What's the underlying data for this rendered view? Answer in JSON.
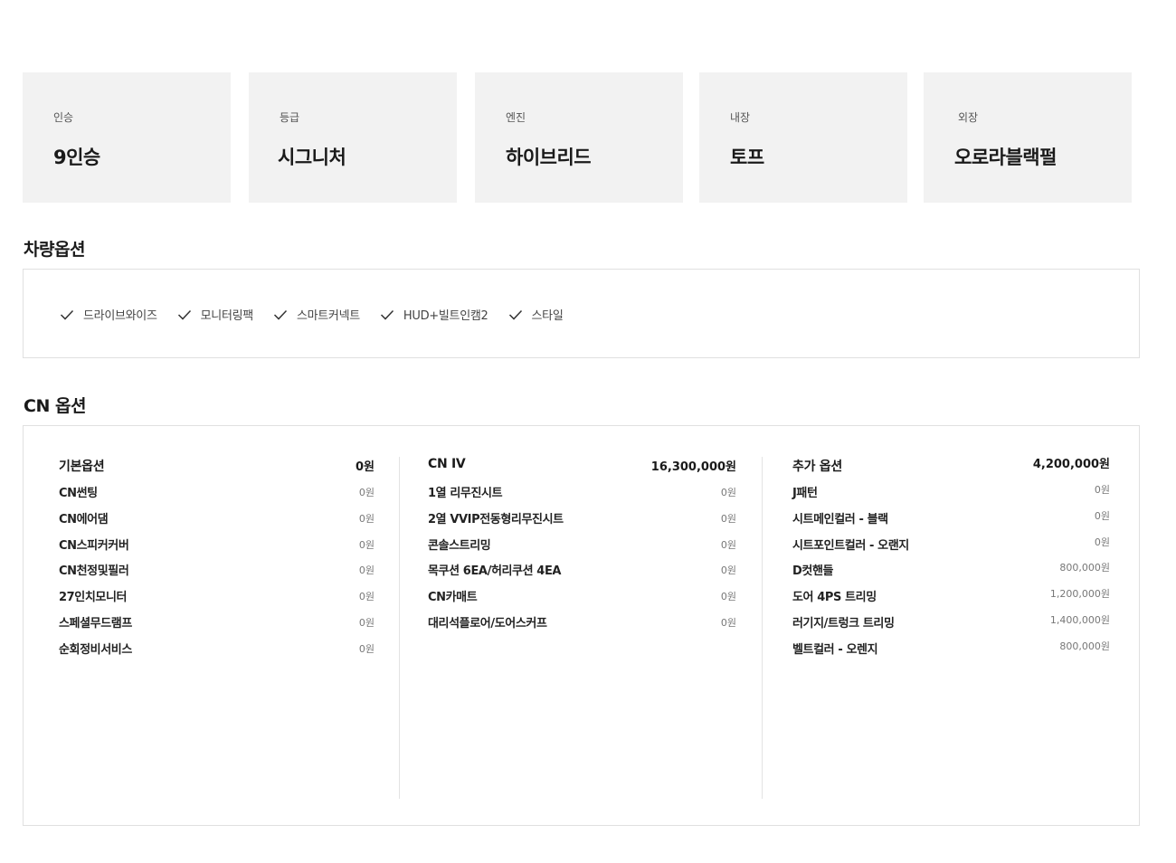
{
  "specs": [
    {
      "label": "인승",
      "value": "9인승"
    },
    {
      "label": "등급",
      "value": "시그니처"
    },
    {
      "label": "엔진",
      "value": "하이브리드"
    },
    {
      "label": "내장",
      "value": "토프"
    },
    {
      "label": "외장",
      "value": "오로라블랙펄"
    }
  ],
  "vehicle_options": {
    "title": "차량옵션",
    "items": [
      "드라이브와이즈",
      "모니터링팩",
      "스마트커넥트",
      "HUD+빌트인캠2",
      "스타일"
    ]
  },
  "cn_options": {
    "title": "CN 옵션",
    "columns": [
      {
        "title": "기본옵션",
        "total": "0원",
        "rows": [
          {
            "name": "CN썬팅",
            "price": "0원"
          },
          {
            "name": "CN에어댐",
            "price": "0원"
          },
          {
            "name": "CN스피커커버",
            "price": "0원"
          },
          {
            "name": "CN천정및필러",
            "price": "0원"
          },
          {
            "name": "27인치모니터",
            "price": "0원"
          },
          {
            "name": "스페셜무드램프",
            "price": "0원"
          },
          {
            "name": "순회정비서비스",
            "price": "0원"
          }
        ]
      },
      {
        "title": "CN IV",
        "total": "16,300,000원",
        "rows": [
          {
            "name": "1열 리무진시트",
            "price": "0원"
          },
          {
            "name": "2열 VVIP전동형리무진시트",
            "price": "0원"
          },
          {
            "name": "콘솔스트리밍",
            "price": "0원"
          },
          {
            "name": "목쿠션 6EA/허리쿠션 4EA",
            "price": "0원"
          },
          {
            "name": "CN카매트",
            "price": "0원"
          },
          {
            "name": "대리석플로어/도어스커프",
            "price": "0원"
          }
        ]
      },
      {
        "title": "추가 옵션",
        "total": "4,200,000원",
        "rows": [
          {
            "name": "J패턴",
            "price": "0원"
          },
          {
            "name": "시트메인컬러 - 블랙",
            "price": "0원"
          },
          {
            "name": "시트포인트컬러 - 오랜지",
            "price": "0원"
          },
          {
            "name": "D컷핸들",
            "price": "800,000원"
          },
          {
            "name": "도어 4PS 트리밍",
            "price": "1,200,000원"
          },
          {
            "name": "러기지/트렁크 트리밍",
            "price": "1,400,000원"
          },
          {
            "name": "벨트컬러 - 오렌지",
            "price": "800,000원"
          }
        ]
      }
    ]
  }
}
